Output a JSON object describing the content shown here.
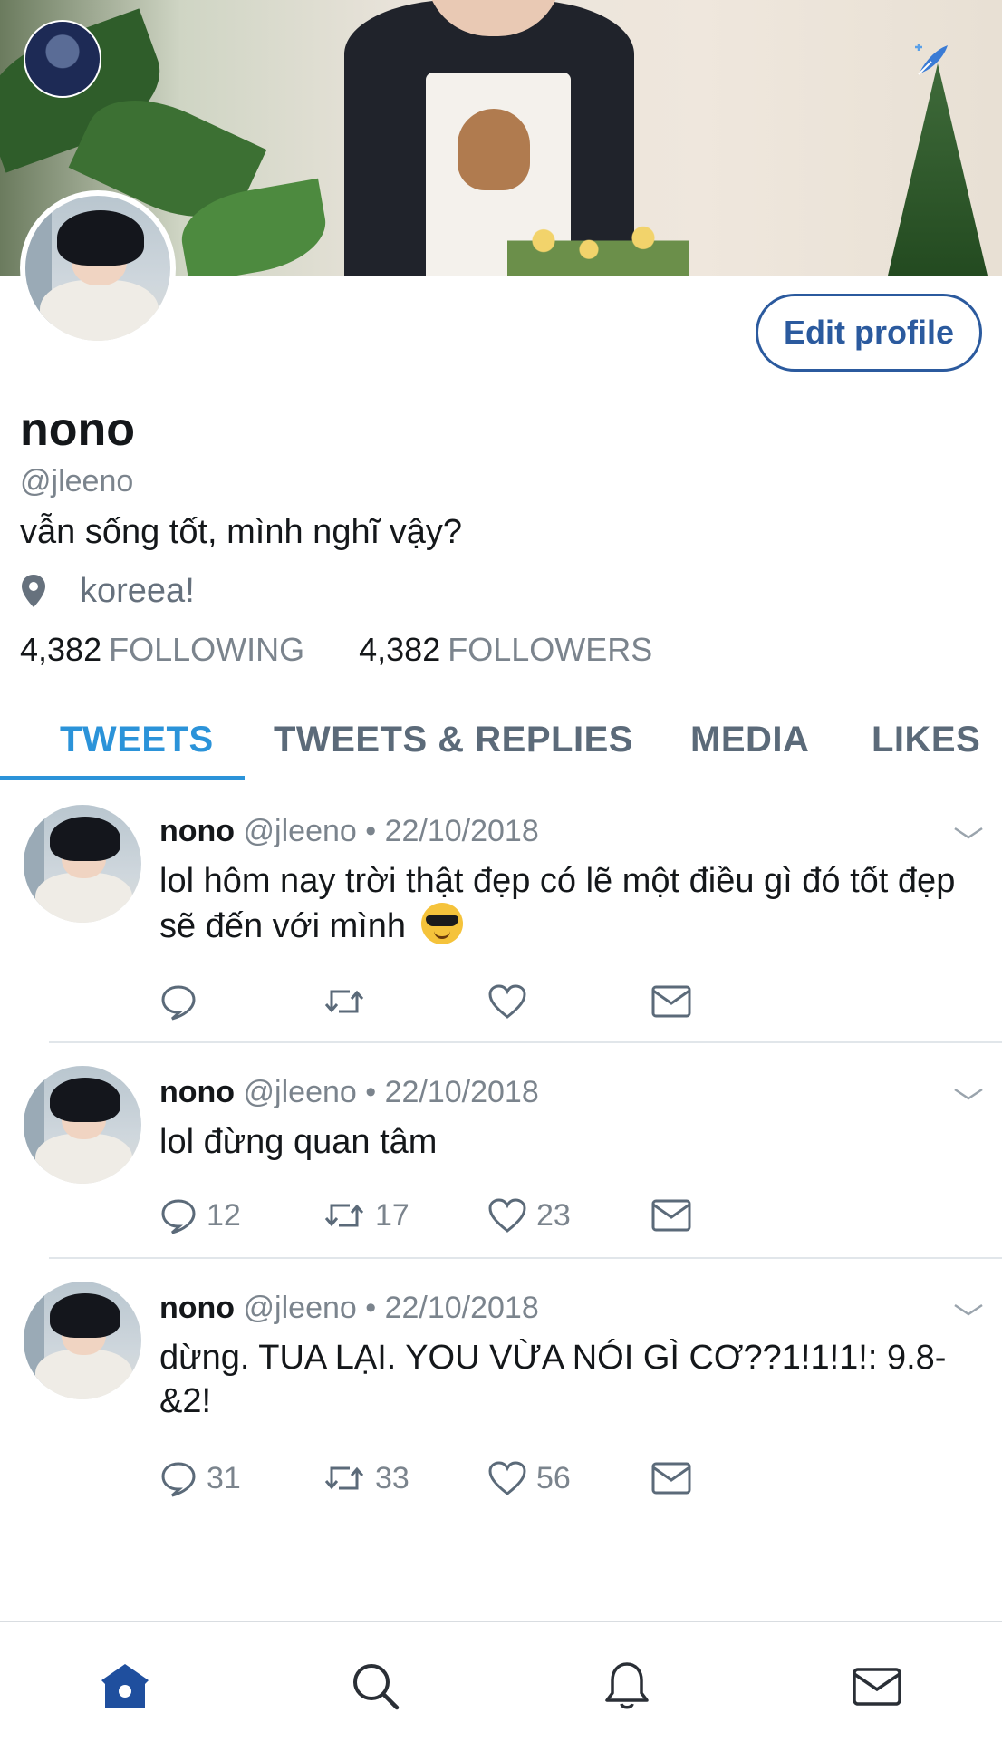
{
  "profile": {
    "name": "nono",
    "handle": "@jleeno",
    "bio": "vẫn sống tốt, mình nghĩ vậy?",
    "location": "koreea!",
    "following_count": "4,382",
    "following_label": "FOLLOWING",
    "followers_count": "4,382",
    "followers_label": "FOLLOWERS",
    "edit_profile_label": "Edit profile"
  },
  "tabs": [
    {
      "label": "TWEETS",
      "active": true
    },
    {
      "label": "TWEETS & REPLIES",
      "active": false
    },
    {
      "label": "MEDIA",
      "active": false
    },
    {
      "label": "LIKES",
      "active": false
    }
  ],
  "tweets": [
    {
      "name": "nono",
      "meta": "@jleeno • 22/10/2018",
      "text": "lol hôm nay trời thật đẹp có lẽ một điều gì đó tốt đẹp sẽ đến với mình",
      "emoji": "smiling-face-with-sunglasses",
      "replies": "",
      "retweets": "",
      "likes": ""
    },
    {
      "name": "nono",
      "meta": "@jleeno • 22/10/2018",
      "text": "lol đừng quan tâm",
      "replies": "12",
      "retweets": "17",
      "likes": "23"
    },
    {
      "name": "nono",
      "meta": "@jleeno • 22/10/2018",
      "text": "dừng. TUA LẠI. YOU VỪA NÓI GÌ CƠ??1!1!1!: 9.8-&2!",
      "replies": "31",
      "retweets": "33",
      "likes": "56"
    }
  ],
  "nav": [
    "home-icon",
    "search-icon",
    "notifications-bell-icon",
    "messages-envelope-icon"
  ],
  "colors": {
    "accent": "#2b93d9",
    "edit_button": "#2b5a9e",
    "muted_text": "#7b848d",
    "nav_active": "#1f4f9e",
    "nav_inactive": "#2a2f36"
  }
}
